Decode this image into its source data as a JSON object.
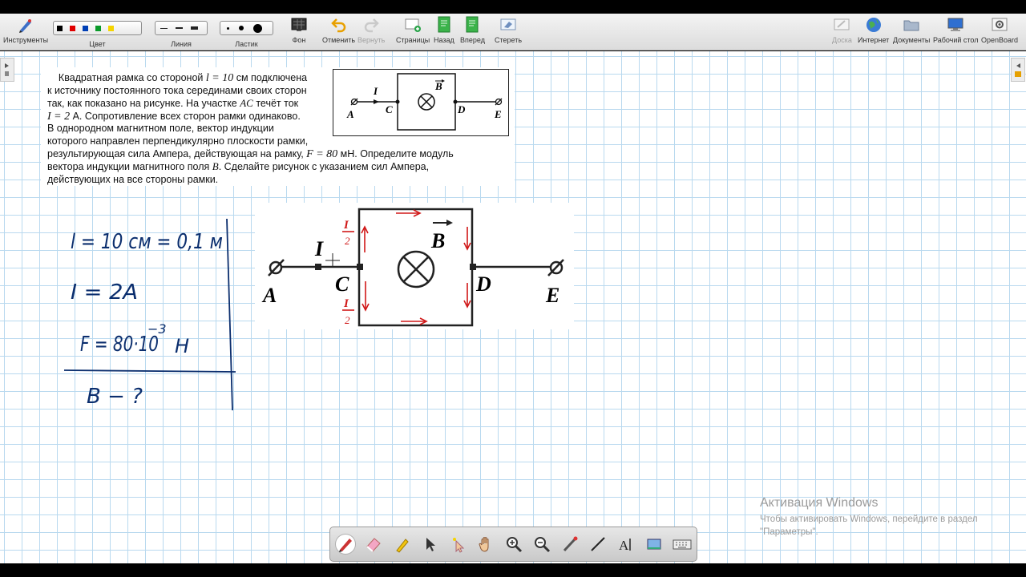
{
  "toolbar": {
    "tools_label": "Инструменты",
    "color_label": "Цвет",
    "colors": [
      "#000000",
      "#e00000",
      "#003fb5",
      "#0a9a2a",
      "#f5d400"
    ],
    "line_label": "Линия",
    "eraser_label": "Ластик",
    "background_label": "Фон",
    "undo_label": "Отменить",
    "redo_label": "Вернуть",
    "pages_label": "Страницы",
    "back_label": "Назад",
    "forward_label": "Вперед",
    "erase_label": "Стереть",
    "board_label": "Доска",
    "internet_label": "Интернет",
    "documents_label": "Документы",
    "desktop_label": "Рабочий стол",
    "app_label": "OpenBoard"
  },
  "task": {
    "lines": [
      [
        "Квадратная рамка со стороной ",
        "l = 10",
        " см подключена"
      ],
      [
        "к источнику постоянного тока серединами своих сторон"
      ],
      [
        "так, как показано на рисунке. На участке ",
        "AC",
        " течёт ток"
      ],
      [
        "I = 2",
        " А. Сопротивление всех сторон рамки одинаково."
      ],
      [
        "В однородном магнитном поле, вектор индукции"
      ],
      [
        "которого направлен перпендикулярно плоскости рамки,"
      ],
      [
        "результирующая сила Ампера, действующая на рамку, ",
        "F = 80",
        " мН. Определите модуль"
      ],
      [
        "вектора индукции магнитного поля ",
        "B",
        ". Сделайте рисунок с указанием сил Ампера,"
      ],
      [
        "действующих на все стороны рамки."
      ]
    ]
  },
  "figure": {
    "point_a": "A",
    "point_c": "C",
    "point_d": "D",
    "point_e": "E",
    "current": "I",
    "field": "B",
    "half_num": "I",
    "half_den": "2"
  },
  "notes": {
    "line1": "l = 10 см = 0,1 м",
    "line2": "I = 2A",
    "line3": "F = 80·10",
    "exp": "−3",
    "unit": "Н",
    "line4": "B − ?"
  },
  "watermark": {
    "title": "Активация Windows",
    "line1": "Чтобы активировать Windows, перейдите в раздел",
    "line2": "\"Параметры\"."
  },
  "bottom_tools": [
    "pen-icon",
    "eraser-icon",
    "marker-icon",
    "pointer-icon",
    "laser-icon",
    "hand-icon",
    "zoom-in-icon",
    "zoom-out-icon",
    "line-tool-icon",
    "straight-line-icon",
    "text-icon",
    "capture-icon",
    "keyboard-icon"
  ]
}
